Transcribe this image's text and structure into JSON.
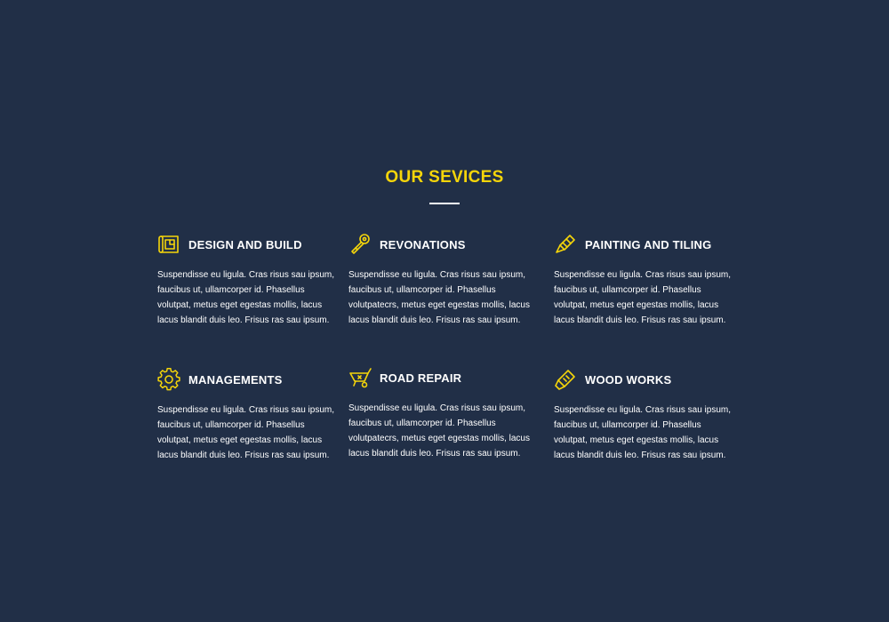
{
  "section": {
    "title": "OUR SEVICES"
  },
  "colors": {
    "background": "#212f47",
    "accent": "#f5d50a",
    "text": "#ffffff"
  },
  "services": [
    {
      "icon": "blueprint-icon",
      "title": "DESIGN AND BUILD",
      "text": "Suspendisse eu ligula. Cras risus sau ipsum, faucibus ut, ullamcorper id. Phasellus volutpat, metus eget egestas mollis, lacus lacus blandit duis leo. Frisus ras sau ipsum."
    },
    {
      "icon": "wrench-icon",
      "title": "REVONATIONS",
      "text": "Suspendisse eu ligula. Cras risus sau ipsum, faucibus ut, ullamcorper id. Phasellus volutpatecrs, metus eget egestas mollis, lacus lacus blandit duis leo. Frisus ras sau ipsum."
    },
    {
      "icon": "paint-brush-icon",
      "title": "PAINTING AND TILING",
      "text": "Suspendisse eu ligula. Cras risus sau ipsum, faucibus ut, ullamcorper id. Phasellus volutpat, metus eget egestas mollis, lacus lacus blandit duis leo. Frisus ras sau ipsum."
    },
    {
      "icon": "gear-icon",
      "title": "MANAGEMENTS",
      "text": "Suspendisse eu ligula. Cras risus sau ipsum, faucibus ut, ullamcorper id. Phasellus volutpat, metus eget egestas mollis, lacus lacus blandit duis leo. Frisus ras sau ipsum."
    },
    {
      "icon": "wheelbarrow-icon",
      "title": "ROAD REPAIR",
      "text": "Suspendisse eu ligula. Cras risus sau ipsum, faucibus ut, ullamcorper id. Phasellus volutpatecrs, metus eget egestas mollis, lacus lacus blandit duis leo. Frisus ras sau ipsum."
    },
    {
      "icon": "chainsaw-icon",
      "title": "WOOD WORKS",
      "text": "Suspendisse eu ligula. Cras risus sau ipsum, faucibus ut, ullamcorper id. Phasellus volutpat, metus eget egestas mollis, lacus lacus blandit duis leo. Frisus ras sau ipsum."
    }
  ]
}
